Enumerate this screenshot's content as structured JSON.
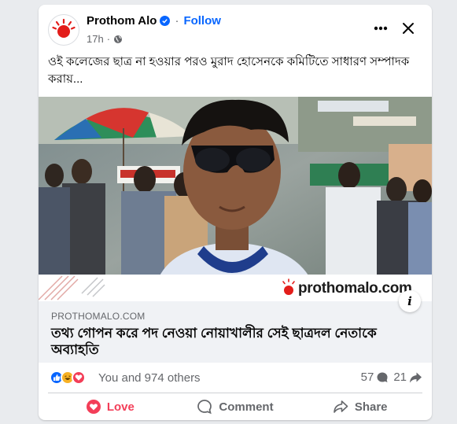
{
  "post": {
    "page_name": "Prothom Alo",
    "follow_label": "Follow",
    "time": "17h",
    "caption": "ওই কলেজের ছাত্র না হওয়ার পরও মুরাদ হোসেনকে কমিটিতে সাধারণ সম্পাদক করায়...",
    "image_watermark": "prothomalo.com"
  },
  "link": {
    "domain": "PROTHOMALO.COM",
    "headline": "তথ্য গোপন করে পদ নেওয়া নোয়াখালীর সেই ছাত্রদল নেতাকে অব্যাহতি",
    "info_label": "i"
  },
  "reactions": {
    "text": "You and 974 others",
    "comments": "57",
    "shares": "21"
  },
  "actions": {
    "love": "Love",
    "comment": "Comment",
    "share": "Share"
  },
  "colors": {
    "brand": "#0866ff",
    "love": "#f33e58",
    "logo_red": "#e31d1a"
  }
}
